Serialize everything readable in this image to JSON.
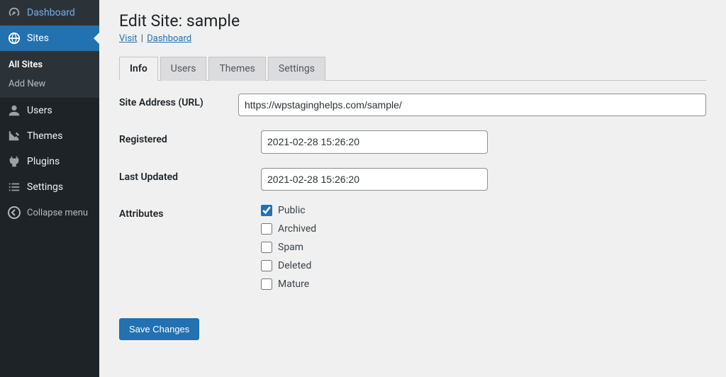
{
  "sidebar": {
    "dashboard": "Dashboard",
    "sites": "Sites",
    "sites_submenu": {
      "all": "All Sites",
      "add_new": "Add New"
    },
    "users": "Users",
    "themes": "Themes",
    "plugins": "Plugins",
    "settings": "Settings",
    "collapse": "Collapse menu"
  },
  "page": {
    "title": "Edit Site: sample",
    "visit": "Visit",
    "dashboard_link": "Dashboard"
  },
  "tabs": {
    "info": "Info",
    "users": "Users",
    "themes": "Themes",
    "settings": "Settings"
  },
  "form": {
    "site_address_label": "Site Address (URL)",
    "site_address_value": "https://wpstaginghelps.com/sample/",
    "registered_label": "Registered",
    "registered_value": "2021-02-28 15:26:20",
    "last_updated_label": "Last Updated",
    "last_updated_value": "2021-02-28 15:26:20",
    "attributes_label": "Attributes",
    "attributes": {
      "public": "Public",
      "archived": "Archived",
      "spam": "Spam",
      "deleted": "Deleted",
      "mature": "Mature"
    },
    "submit": "Save Changes"
  }
}
